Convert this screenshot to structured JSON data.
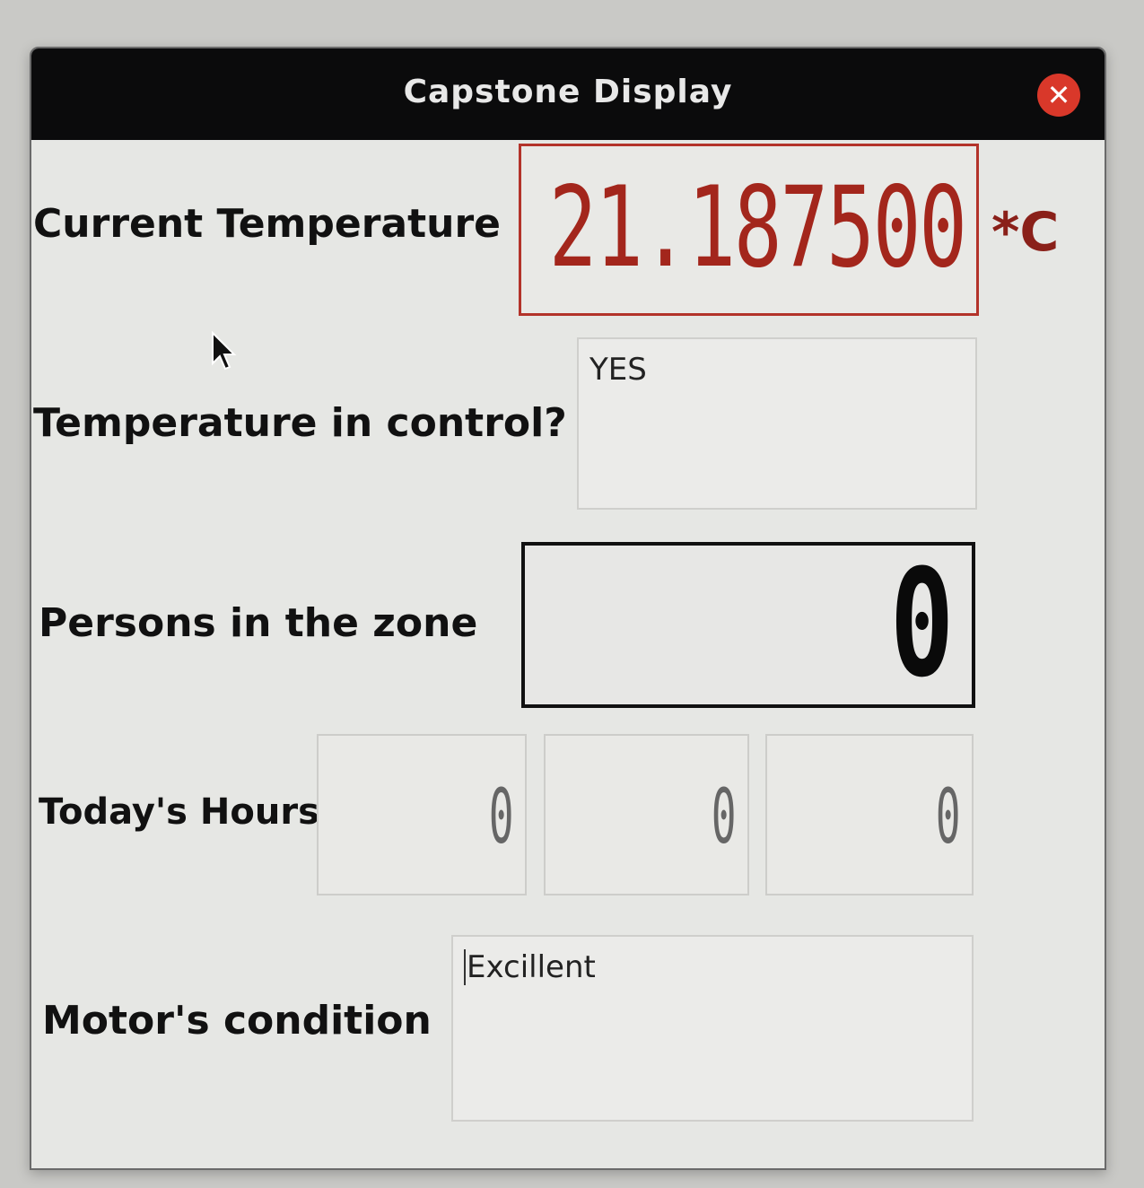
{
  "window": {
    "title": "Capstone Display",
    "close_icon": "close-icon"
  },
  "temperature": {
    "label": "Current Temperature",
    "value": "21.187500",
    "unit": "*C",
    "display_color": "#a3261c"
  },
  "control": {
    "label": "Temperature in control?",
    "value": "YES"
  },
  "persons": {
    "label": "Persons in the zone",
    "value": "0"
  },
  "hours": {
    "label": "Today's Hours",
    "digits": [
      "0",
      "0",
      "0"
    ]
  },
  "motor": {
    "label": "Motor's condition",
    "value": "Excillent"
  },
  "pointer": "mouse-pointer-icon"
}
